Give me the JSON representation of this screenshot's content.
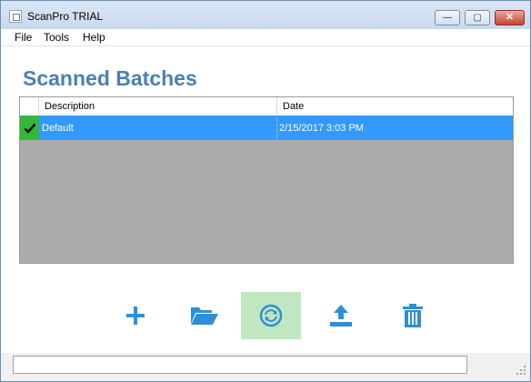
{
  "window": {
    "title": "ScanPro TRIAL",
    "controls": {
      "minimize": "—",
      "maximize": "▢",
      "close": "✕"
    }
  },
  "menu": {
    "items": [
      {
        "label": "File"
      },
      {
        "label": "Tools"
      },
      {
        "label": "Help"
      }
    ]
  },
  "main": {
    "heading": "Scanned Batches",
    "table": {
      "columns": [
        "",
        "Description",
        "Date"
      ],
      "rows": [
        {
          "selected": true,
          "description": "Default",
          "date": "2/15/2017 3:03 PM"
        }
      ]
    }
  },
  "toolbar": {
    "buttons": [
      {
        "icon": "plus-icon",
        "active": false
      },
      {
        "icon": "folder-open-icon",
        "active": false
      },
      {
        "icon": "sync-icon",
        "active": true
      },
      {
        "icon": "upload-icon",
        "active": false
      },
      {
        "icon": "trash-icon",
        "active": false
      }
    ]
  },
  "status": {
    "text": ""
  },
  "colors": {
    "heading": "#4a80b5",
    "selection": "#3399ff",
    "check": "#34b83a",
    "icon": "#2e8fd8",
    "active_button": "#bfe8c0",
    "grid_background": "#ababab"
  }
}
